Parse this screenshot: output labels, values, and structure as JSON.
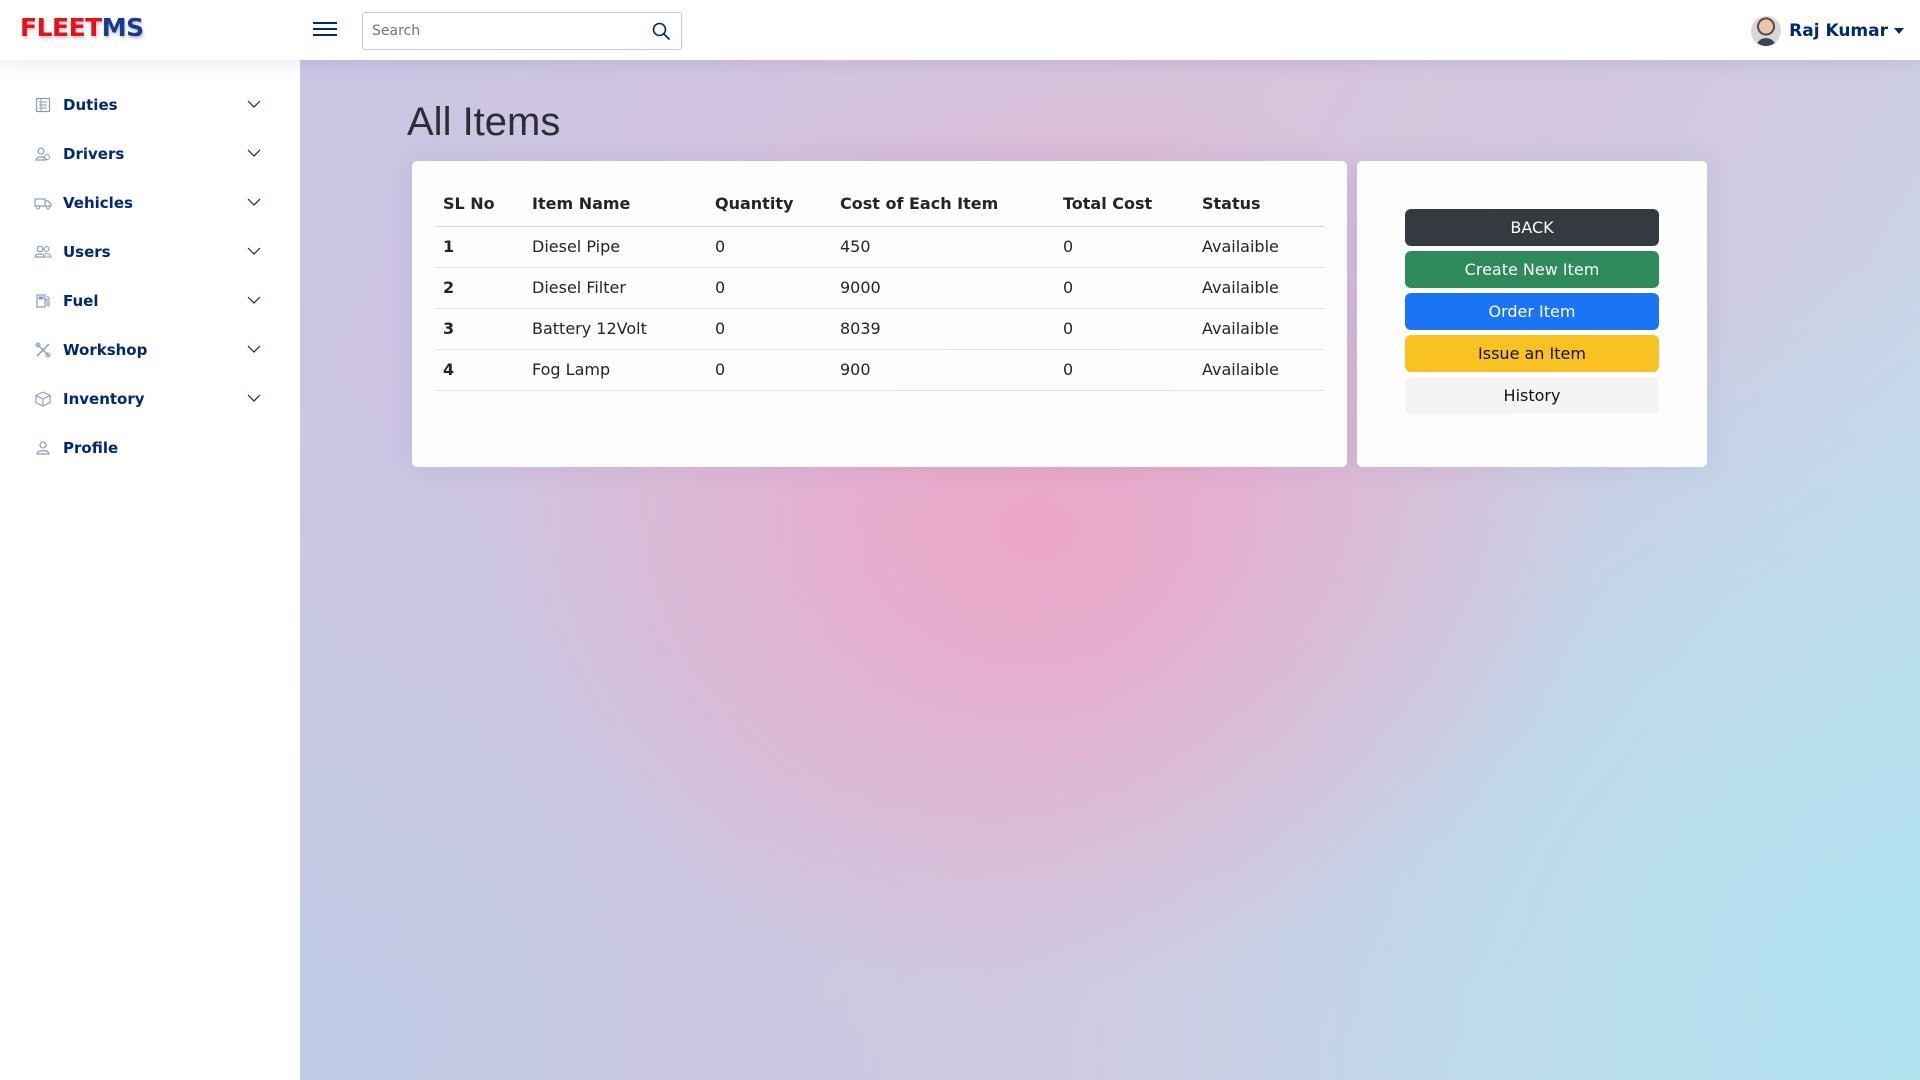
{
  "header": {
    "logo_part1": "FLEET",
    "logo_part2": "MS",
    "search_placeholder": "Search",
    "user_name": "Raj Kumar"
  },
  "sidebar": {
    "items": [
      {
        "label": "Duties",
        "icon": "duties-icon",
        "expandable": true
      },
      {
        "label": "Drivers",
        "icon": "drivers-icon",
        "expandable": true
      },
      {
        "label": "Vehicles",
        "icon": "vehicles-icon",
        "expandable": true
      },
      {
        "label": "Users",
        "icon": "users-icon",
        "expandable": true
      },
      {
        "label": "Fuel",
        "icon": "fuel-icon",
        "expandable": true
      },
      {
        "label": "Workshop",
        "icon": "workshop-icon",
        "expandable": true
      },
      {
        "label": "Inventory",
        "icon": "inventory-icon",
        "expandable": true
      },
      {
        "label": "Profile",
        "icon": "profile-icon",
        "expandable": false
      }
    ]
  },
  "main": {
    "title": "All Items",
    "table": {
      "headers": [
        "SL No",
        "Item Name",
        "Quantity",
        "Cost of Each Item",
        "Total Cost",
        "Status"
      ],
      "rows": [
        [
          "1",
          "Diesel Pipe",
          "0",
          "450",
          "0",
          "Availaible"
        ],
        [
          "2",
          "Diesel Filter",
          "0",
          "9000",
          "0",
          "Availaible"
        ],
        [
          "3",
          "Battery 12Volt",
          "0",
          "8039",
          "0",
          "Availaible"
        ],
        [
          "4",
          "Fog Lamp",
          "0",
          "900",
          "0",
          "Availaible"
        ]
      ]
    },
    "actions": {
      "back": "BACK",
      "create": "Create New Item",
      "order": "Order Item",
      "issue": "Issue an Item",
      "history": "History"
    }
  },
  "colors": {
    "brand_red": "#e0141e",
    "brand_navy": "#1b3a8f",
    "nav_text": "#012970",
    "btn_dark": "#343a40",
    "btn_green": "#2f8a5b",
    "btn_blue": "#1b74f4",
    "btn_yellow": "#f7c222",
    "btn_light": "#f4f4f5"
  }
}
